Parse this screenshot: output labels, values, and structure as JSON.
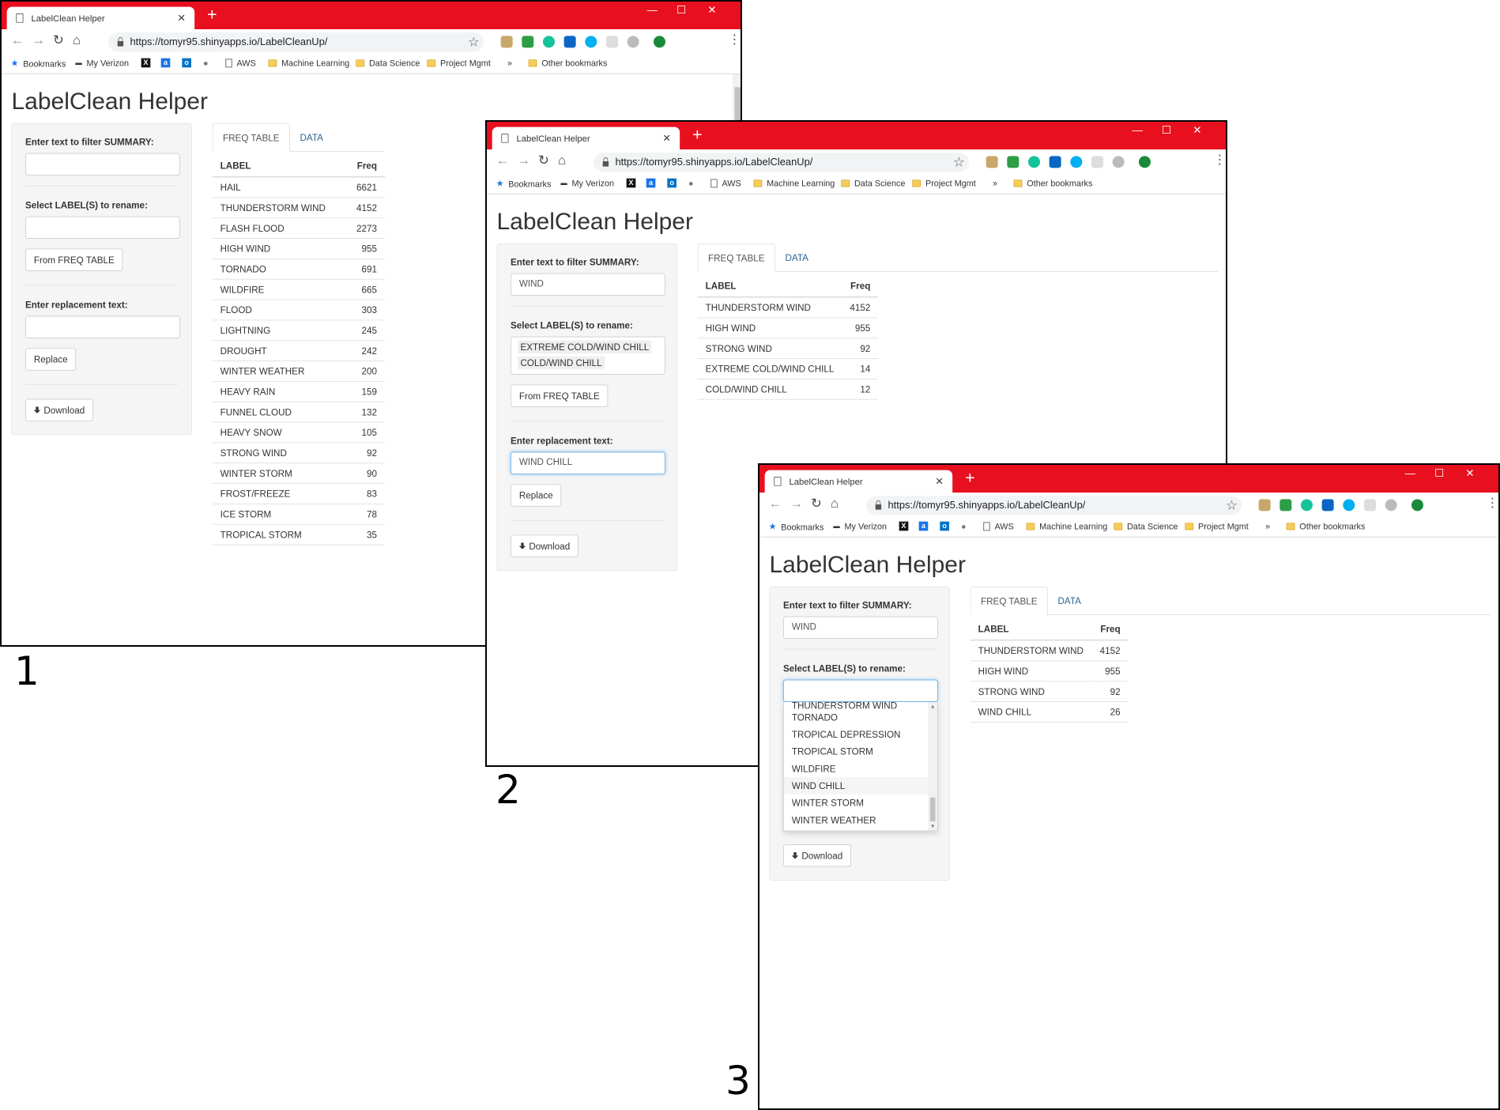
{
  "browser": {
    "tab_title": "LabelClean Helper",
    "url": "https://tomyr95.shinyapps.io/LabelCleanUp/",
    "bookmarks": [
      "Bookmarks",
      "My Verizon",
      "AWS",
      "Machine Learning",
      "Data Science",
      "Project Mgmt"
    ],
    "overflow": "»",
    "other_bookmarks": "Other bookmarks",
    "accent": "#e8101f"
  },
  "app": {
    "title": "LabelClean Helper",
    "filter_label": "Enter text to filter SUMMARY:",
    "select_label": "Select LABEL(S) to rename:",
    "from_freq_button": "From FREQ TABLE",
    "replacement_label": "Enter replacement text:",
    "replace_button": "Replace",
    "download_button": "Download",
    "tab_freq": "FREQ TABLE",
    "tab_data": "DATA",
    "col_label": "LABEL",
    "col_freq": "Freq"
  },
  "shots": [
    {
      "number": "1",
      "filter_value": "",
      "replacement_value": "",
      "rows": [
        {
          "label": "HAIL",
          "freq": "6621"
        },
        {
          "label": "THUNDERSTORM WIND",
          "freq": "4152"
        },
        {
          "label": "FLASH FLOOD",
          "freq": "2273"
        },
        {
          "label": "HIGH WIND",
          "freq": "955"
        },
        {
          "label": "TORNADO",
          "freq": "691"
        },
        {
          "label": "WILDFIRE",
          "freq": "665"
        },
        {
          "label": "FLOOD",
          "freq": "303"
        },
        {
          "label": "LIGHTNING",
          "freq": "245"
        },
        {
          "label": "DROUGHT",
          "freq": "242"
        },
        {
          "label": "WINTER WEATHER",
          "freq": "200"
        },
        {
          "label": "HEAVY RAIN",
          "freq": "159"
        },
        {
          "label": "FUNNEL CLOUD",
          "freq": "132"
        },
        {
          "label": "HEAVY SNOW",
          "freq": "105"
        },
        {
          "label": "STRONG WIND",
          "freq": "92"
        },
        {
          "label": "WINTER STORM",
          "freq": "90"
        },
        {
          "label": "FROST/FREEZE",
          "freq": "83"
        },
        {
          "label": "ICE STORM",
          "freq": "78"
        },
        {
          "label": "TROPICAL STORM",
          "freq": "35"
        }
      ]
    },
    {
      "number": "2",
      "filter_value": "WIND",
      "selected_labels": [
        "EXTREME COLD/WIND CHILL",
        "COLD/WIND CHILL"
      ],
      "replacement_value": "WIND CHILL",
      "rows": [
        {
          "label": "THUNDERSTORM WIND",
          "freq": "4152"
        },
        {
          "label": "HIGH WIND",
          "freq": "955"
        },
        {
          "label": "STRONG WIND",
          "freq": "92"
        },
        {
          "label": "EXTREME COLD/WIND CHILL",
          "freq": "14"
        },
        {
          "label": "COLD/WIND CHILL",
          "freq": "12"
        }
      ]
    },
    {
      "number": "3",
      "filter_value": "WIND",
      "dropdown_options": [
        "THUNDERSTORM WIND",
        "TORNADO",
        "TROPICAL DEPRESSION",
        "TROPICAL STORM",
        "WILDFIRE",
        "WIND CHILL",
        "WINTER STORM",
        "WINTER WEATHER"
      ],
      "dropdown_highlighted": "WIND CHILL",
      "rows": [
        {
          "label": "THUNDERSTORM WIND",
          "freq": "4152"
        },
        {
          "label": "HIGH WIND",
          "freq": "955"
        },
        {
          "label": "STRONG WIND",
          "freq": "92"
        },
        {
          "label": "WIND CHILL",
          "freq": "26"
        }
      ]
    }
  ]
}
